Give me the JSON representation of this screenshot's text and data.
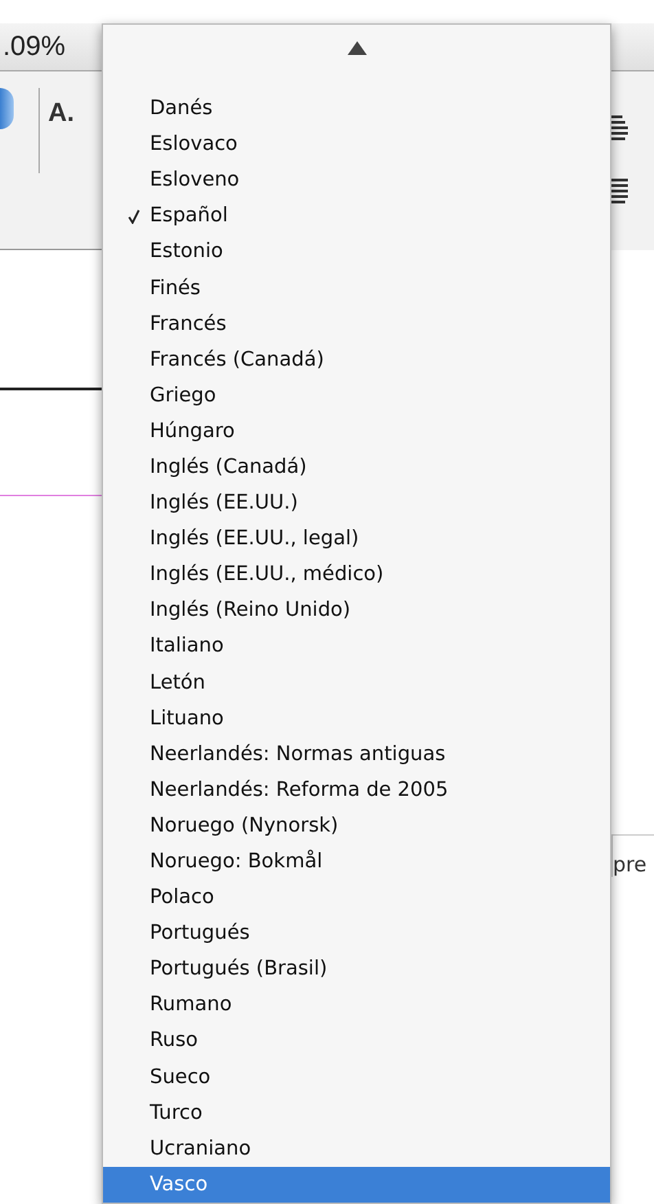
{
  "toolbar": {
    "zoom": ".09%",
    "char_style": "A."
  },
  "language_menu": {
    "items": [
      {
        "label": "Danés",
        "checked": false,
        "highlighted": false
      },
      {
        "label": "Eslovaco",
        "checked": false,
        "highlighted": false
      },
      {
        "label": "Esloveno",
        "checked": false,
        "highlighted": false
      },
      {
        "label": "Español",
        "checked": true,
        "highlighted": false
      },
      {
        "label": "Estonio",
        "checked": false,
        "highlighted": false
      },
      {
        "label": "Finés",
        "checked": false,
        "highlighted": false
      },
      {
        "label": "Francés",
        "checked": false,
        "highlighted": false
      },
      {
        "label": "Francés (Canadá)",
        "checked": false,
        "highlighted": false
      },
      {
        "label": "Griego",
        "checked": false,
        "highlighted": false
      },
      {
        "label": "Húngaro",
        "checked": false,
        "highlighted": false
      },
      {
        "label": "Inglés (Canadá)",
        "checked": false,
        "highlighted": false
      },
      {
        "label": "Inglés (EE.UU.)",
        "checked": false,
        "highlighted": false
      },
      {
        "label": "Inglés (EE.UU., legal)",
        "checked": false,
        "highlighted": false
      },
      {
        "label": "Inglés (EE.UU., médico)",
        "checked": false,
        "highlighted": false
      },
      {
        "label": "Inglés (Reino Unido)",
        "checked": false,
        "highlighted": false
      },
      {
        "label": "Italiano",
        "checked": false,
        "highlighted": false
      },
      {
        "label": "Letón",
        "checked": false,
        "highlighted": false
      },
      {
        "label": "Lituano",
        "checked": false,
        "highlighted": false
      },
      {
        "label": "Neerlandés: Normas antiguas",
        "checked": false,
        "highlighted": false
      },
      {
        "label": "Neerlandés: Reforma de 2005",
        "checked": false,
        "highlighted": false
      },
      {
        "label": "Noruego (Nynorsk)",
        "checked": false,
        "highlighted": false
      },
      {
        "label": "Noruego: Bokmål",
        "checked": false,
        "highlighted": false
      },
      {
        "label": "Polaco",
        "checked": false,
        "highlighted": false
      },
      {
        "label": "Portugués",
        "checked": false,
        "highlighted": false
      },
      {
        "label": "Portugués (Brasil)",
        "checked": false,
        "highlighted": false
      },
      {
        "label": "Rumano",
        "checked": false,
        "highlighted": false
      },
      {
        "label": "Ruso",
        "checked": false,
        "highlighted": false
      },
      {
        "label": "Sueco",
        "checked": false,
        "highlighted": false
      },
      {
        "label": "Turco",
        "checked": false,
        "highlighted": false
      },
      {
        "label": "Ucraniano",
        "checked": false,
        "highlighted": false
      },
      {
        "label": "Vasco",
        "checked": false,
        "highlighted": true
      }
    ]
  },
  "preview_field": {
    "value": "pre"
  }
}
